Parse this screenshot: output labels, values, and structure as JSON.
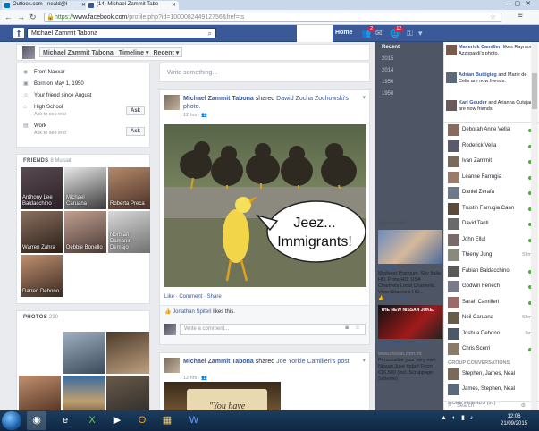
{
  "browser": {
    "tabs": [
      {
        "label": "Outlook.com - neald@l",
        "icon": "outlook-icon",
        "color": "#0072c6"
      },
      {
        "label": "(14) Michael Zammit Tabo",
        "icon": "facebook-icon",
        "color": "#3b5998"
      }
    ],
    "url_scheme": "https://",
    "url_host": "www.facebook.com",
    "url_path": "/profile.php?id=100008244912756&fref=ts"
  },
  "fb": {
    "search_value": "Michael Zammit Tabona",
    "home_label": "Home",
    "friend_req_badge": "2",
    "notif_badge": "12"
  },
  "cover": {
    "name": "Michael Zammit Tabona",
    "timeline_label": "Timeline",
    "recent_label": "Recent"
  },
  "intro": {
    "from": "From Naxxar",
    "born": "Born on May 1, 1950",
    "friend_since": "Your friend since August",
    "school": "High School",
    "school_sub": "Ask to see info",
    "work": "Work",
    "work_sub": "Ask to see info",
    "ask_label": "Ask"
  },
  "friends": {
    "title": "FRIENDS",
    "count": "8 Mutual",
    "items": [
      {
        "name": "Anthony Lee Baldacchino",
        "bg": "#3a3036"
      },
      {
        "name": "Michael Caruana",
        "bg": "#2f2f2f"
      },
      {
        "name": "Roberta Preca",
        "bg": "#6b4a3a"
      },
      {
        "name": "Warren Zahra",
        "bg": "#4a3a2e"
      },
      {
        "name": "Debbie Bonello",
        "bg": "#5a4a44"
      },
      {
        "name": "Norman Damanin Demajo",
        "bg": "#a8a8a8"
      },
      {
        "name": "Darren Debono",
        "bg": "#6b4e40"
      }
    ]
  },
  "photos": {
    "title": "PHOTOS",
    "count": "230"
  },
  "composer": {
    "placeholder": "Write something..."
  },
  "post1": {
    "author": "Michael Zammit Tabona",
    "action": "shared",
    "shared_from": "Dawid Zocha Zochowski's",
    "object": "photo.",
    "time": "12 hrs",
    "bubble_line1": "Jeez...",
    "bubble_line2": "Immigrants!",
    "actions": "Like · Comment · Share",
    "liker": "Jonathan Spiteri",
    "likes_suffix": "likes this.",
    "comment_placeholder": "Write a comment..."
  },
  "post2": {
    "author": "Michael Zammit Tabona",
    "action": "shared",
    "shared_from": "Joe Yorkie Camilleri's",
    "object": "post",
    "time": "12 hrs",
    "image_text": "\"You have"
  },
  "timeline_years": [
    "Recent",
    "2015",
    "2014",
    "1950",
    "1950"
  ],
  "sponsored": {
    "header": "Sponsored",
    "ad1_title": "3Group",
    "ad1_text": "Medeset Premium, Sky Italia HD, PrimaHD, USA Channels Local Channels, View Channels HD...",
    "ad1_like": "Like Page",
    "ad2_banner": "THE NEW NISSAN JUKE.",
    "ad2_title": "ADD THRILL TO YOUR LIFE",
    "ad2_url": "www.nissan.com.mt",
    "ad2_text": "Personalise your very own Nissan Juke today! From €16,500 (incl. Scrappage Scheme)"
  },
  "ticker": [
    {
      "name": "Maverick Camilleri",
      "text": "likes Raymond Azzopardi's photo.",
      "bg": "#7a5a4a"
    },
    {
      "name": "Adrian Buttigieg",
      "text": "and Marie de Celis are now friends.",
      "bg": "#5a6a7a"
    },
    {
      "name": "Karl Gouder",
      "text": "and Arianna Cutajar are now friends.",
      "bg": "#6a5a5a"
    }
  ],
  "chat": {
    "contacts": [
      {
        "name": "Deborah Anne Vella",
        "status": "",
        "bg": "#8a6a5a"
      },
      {
        "name": "Roderick Vella",
        "status": "",
        "bg": "#5a5a6a"
      },
      {
        "name": "Ivan Zammit",
        "status": "",
        "bg": "#7a6a5a"
      },
      {
        "name": "Leanne Farrugia",
        "status": "",
        "bg": "#9a7a6a"
      },
      {
        "name": "Daniel Zerafa",
        "status": "",
        "bg": "#6a7a8a"
      },
      {
        "name": "Trustin Farrugia Cann",
        "status": "",
        "bg": "#5a4a3a"
      },
      {
        "name": "David Tanti",
        "status": "",
        "bg": "#6a6a6a"
      },
      {
        "name": "John Ellul",
        "status": "",
        "bg": "#7a6a6a"
      },
      {
        "name": "Thierry Jung",
        "status": "59m",
        "bg": "#8a8a7a"
      },
      {
        "name": "Fabian Baldacchino",
        "status": "",
        "bg": "#5a5a5a"
      },
      {
        "name": "Godwin Fenech",
        "status": "",
        "bg": "#7a7a8a"
      },
      {
        "name": "Sarah Camilleri",
        "status": "",
        "bg": "#9a6a6a"
      },
      {
        "name": "Neil Caruana",
        "status": "59m",
        "bg": "#6a5a4a"
      },
      {
        "name": "Joshua Debono",
        "status": "9m",
        "bg": "#4a5a6a"
      },
      {
        "name": "Chris Scerri",
        "status": "",
        "bg": "#8a7a6a"
      }
    ],
    "group_header": "GROUP CONVERSATIONS",
    "groups": [
      "Stephen, James, Neal",
      "James, Stephen, Neal"
    ],
    "more_header": "MORE FRIENDS (57)",
    "search_placeholder": "Search"
  },
  "taskbar": {
    "time": "12:06",
    "date": "21/09/2015"
  }
}
